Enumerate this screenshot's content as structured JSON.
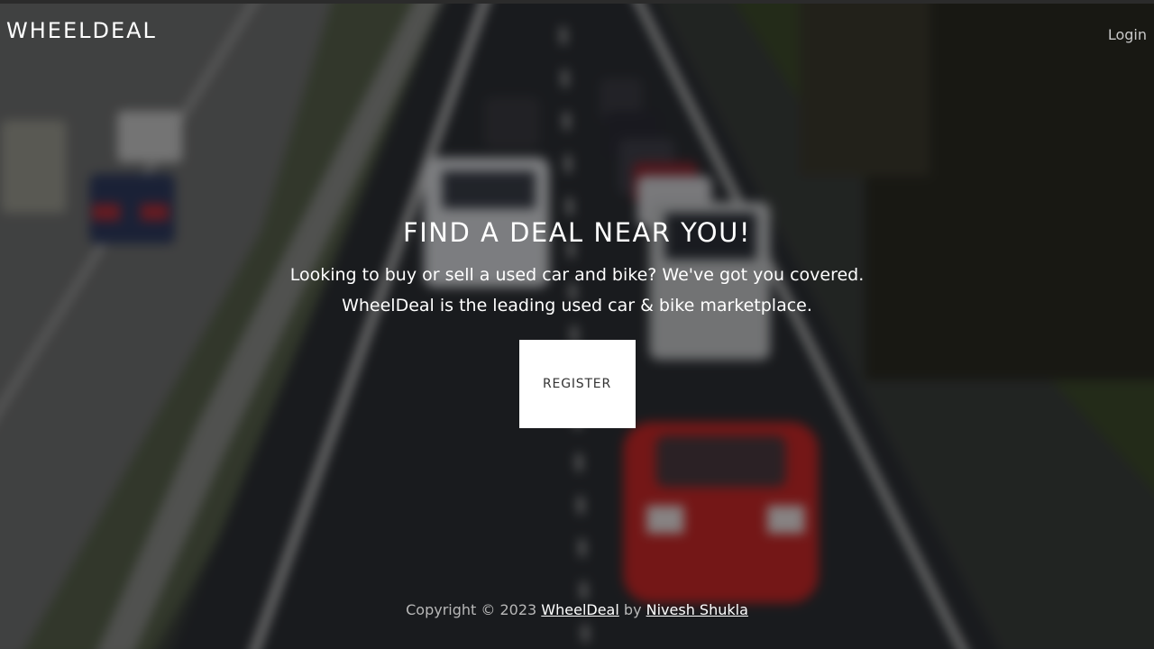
{
  "navbar": {
    "brand": "WHEELDEAL",
    "login_label": "Login"
  },
  "hero": {
    "title": "FIND A DEAL NEAR YOU!",
    "lead_line1": "Looking to buy or sell a used car and bike? We've got you covered.",
    "lead_line2": "WheelDeal is the leading used car & bike marketplace.",
    "register_label": "REGISTER"
  },
  "footer": {
    "copyright_prefix": "Copyright © 2023",
    "site_link": "WheelDeal",
    "by_text": "by",
    "author_link": "Nivesh Shukla"
  },
  "colors": {
    "overlay": "#000000",
    "text": "#ffffff",
    "button_bg": "#ffffff",
    "button_text": "#333333",
    "footer_text": "#b8b8b8"
  },
  "background": {
    "description_icon": "highway-photo"
  }
}
